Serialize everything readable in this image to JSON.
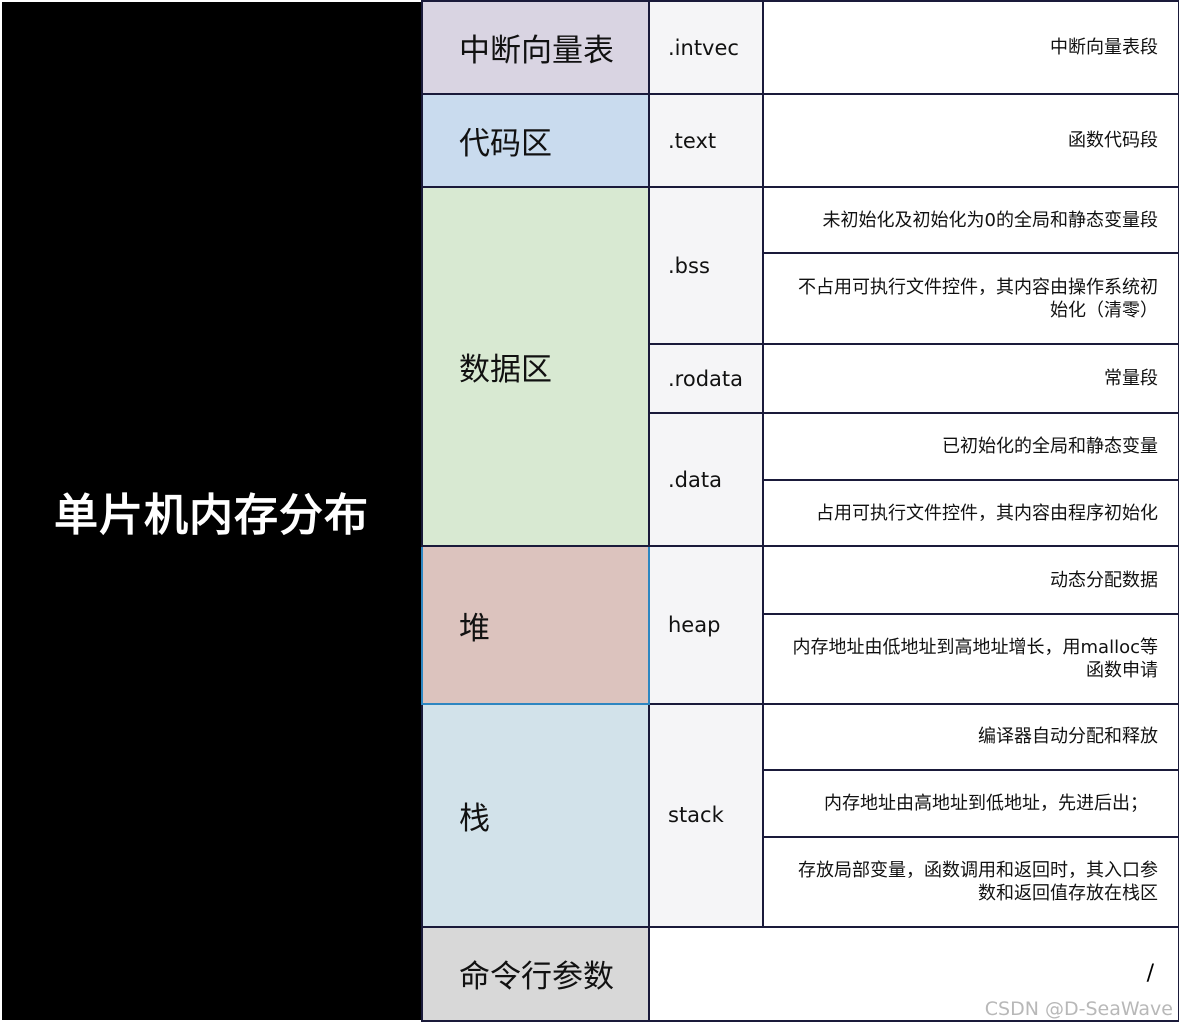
{
  "title": "单片机内存分布",
  "colors": {
    "intvec": "#d9d4e2",
    "text": "#c9dbee",
    "data": "#d8e9d2",
    "heap": "#dcc3be",
    "stack": "#d2e2ea",
    "args": "#d8d8d8"
  },
  "rows": {
    "intvec": {
      "category": "中断向量表",
      "section": ".intvec",
      "desc": "中断向量表段"
    },
    "text": {
      "category": "代码区",
      "section": ".text",
      "desc": "函数代码段"
    },
    "data_region": {
      "category": "数据区"
    },
    "bss": {
      "section": ".bss",
      "desc1": "未初始化及初始化为0的全局和静态变量段",
      "desc2": "不占用可执行文件控件，其内容由操作系统初始化（清零）"
    },
    "rodata": {
      "section": ".rodata",
      "desc": "常量段"
    },
    "data": {
      "section": ".data",
      "desc1": "已初始化的全局和静态变量",
      "desc2": "占用可执行文件控件，其内容由程序初始化"
    },
    "heap": {
      "category": "堆",
      "section": "heap",
      "desc1": "动态分配数据",
      "desc2": "内存地址由低地址到高地址增长，用malloc等函数申请"
    },
    "stack": {
      "category": "栈",
      "section": "stack",
      "desc1": "编译器自动分配和释放",
      "desc2": "内存地址由高地址到低地址，先进后出；",
      "desc3": "存放局部变量，函数调用和返回时，其入口参数和返回值存放在栈区"
    },
    "args": {
      "category": "命令行参数",
      "desc": "/"
    }
  },
  "watermark": "CSDN @D-SeaWave"
}
